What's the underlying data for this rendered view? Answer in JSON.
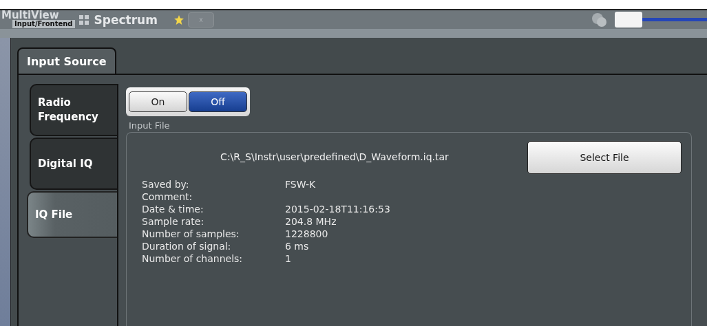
{
  "title_bar": {
    "multiview_label": "MultiView",
    "active_channel": "Input/Frontend",
    "channel_tab": "Spectrum",
    "close_label": "x"
  },
  "dialog": {
    "tabs": [
      {
        "label": "Input Source",
        "selected": true
      }
    ],
    "side_tabs": [
      {
        "label": "Radio Frequency",
        "selected": false
      },
      {
        "label": "Digital IQ",
        "selected": false
      },
      {
        "label": "IQ File",
        "selected": true
      }
    ],
    "state_toggle": [
      {
        "label": "On",
        "selected": false
      },
      {
        "label": "Off",
        "selected": true
      }
    ],
    "input_file": {
      "group_label": "Input File",
      "path": "C:\\R_S\\Instr\\user\\predefined\\D_Waveform.iq.tar",
      "button": "Select File",
      "details": [
        {
          "label": "Saved by:",
          "value": "FSW-K"
        },
        {
          "label": "Comment:"
        },
        {
          "label": "Date & time:",
          "value": "2015-02-18T11:16:53"
        },
        {
          "label": "Sample rate:",
          "value": "204.8 MHz"
        },
        {
          "label": "Number of samples:",
          "value": "1228800"
        },
        {
          "label": "Duration of signal:",
          "value": "6 ms"
        },
        {
          "label": "Number of channels:",
          "value": "1"
        }
      ]
    }
  }
}
